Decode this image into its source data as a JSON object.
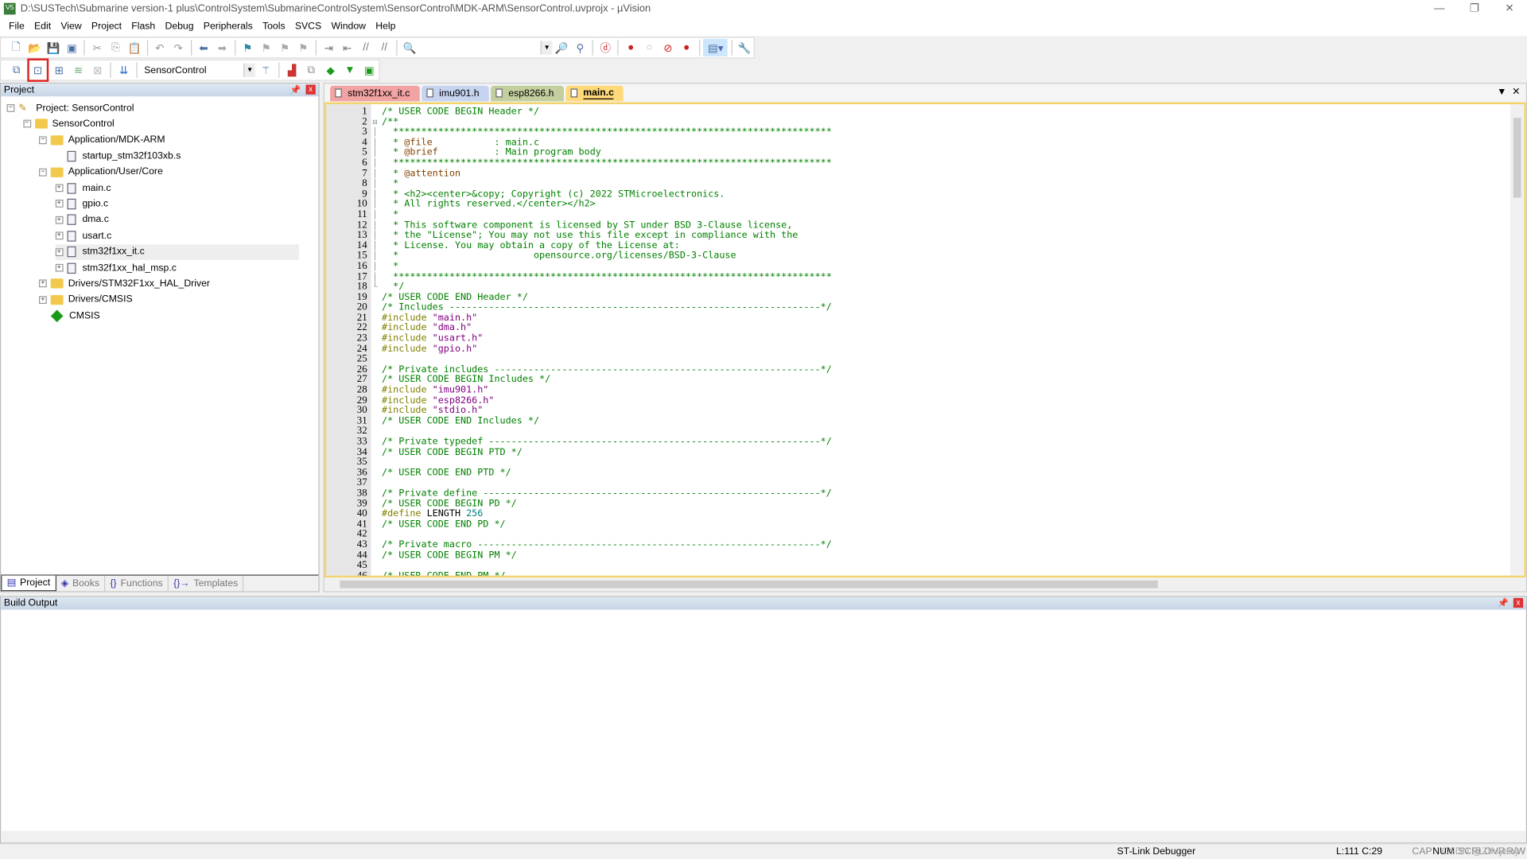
{
  "window": {
    "title": "D:\\SUSTech\\Submarine version-1 plus\\ControlSystem\\SubmarineControlSystem\\SensorControl\\MDK-ARM\\SensorControl.uvprojx - µVision",
    "logo": "V5"
  },
  "menu": [
    "File",
    "Edit",
    "View",
    "Project",
    "Flash",
    "Debug",
    "Peripherals",
    "Tools",
    "SVCS",
    "Window",
    "Help"
  ],
  "toolbar2": {
    "target": "SensorControl",
    "highlighted_button": "build-icon",
    "highlight_color": "#e02020"
  },
  "project_pane": {
    "title": "Project",
    "tree": [
      {
        "label": "Project: SensorControl",
        "depth": 0,
        "kind": "project",
        "exp": "−"
      },
      {
        "label": "SensorControl",
        "depth": 1,
        "kind": "folder",
        "exp": "−"
      },
      {
        "label": "Application/MDK-ARM",
        "depth": 2,
        "kind": "folder",
        "exp": "−"
      },
      {
        "label": "startup_stm32f103xb.s",
        "depth": 3,
        "kind": "file",
        "exp": ""
      },
      {
        "label": "Application/User/Core",
        "depth": 2,
        "kind": "folder",
        "exp": "−"
      },
      {
        "label": "main.c",
        "depth": 3,
        "kind": "file",
        "exp": "+"
      },
      {
        "label": "gpio.c",
        "depth": 3,
        "kind": "file",
        "exp": "+"
      },
      {
        "label": "dma.c",
        "depth": 3,
        "kind": "file",
        "exp": "+"
      },
      {
        "label": "usart.c",
        "depth": 3,
        "kind": "file",
        "exp": "+"
      },
      {
        "label": "stm32f1xx_it.c",
        "depth": 3,
        "kind": "file",
        "exp": "+",
        "selected": true
      },
      {
        "label": "stm32f1xx_hal_msp.c",
        "depth": 3,
        "kind": "file",
        "exp": "+"
      },
      {
        "label": "Drivers/STM32F1xx_HAL_Driver",
        "depth": 2,
        "kind": "folder",
        "exp": "+"
      },
      {
        "label": "Drivers/CMSIS",
        "depth": 2,
        "kind": "folder",
        "exp": "+"
      },
      {
        "label": "CMSIS",
        "depth": 2,
        "kind": "component",
        "exp": ""
      }
    ],
    "tabs": [
      {
        "label": "Project",
        "icon": "▤",
        "active": true
      },
      {
        "label": "Books",
        "icon": "◈"
      },
      {
        "label": "Functions",
        "icon": "{}"
      },
      {
        "label": "Templates",
        "icon": "{}→"
      }
    ]
  },
  "editor": {
    "tabs": [
      {
        "label": "stm32f1xx_it.c",
        "color": "#f2a3a3"
      },
      {
        "label": "imu901.h",
        "color": "#c6d4f0"
      },
      {
        "label": "esp8266.h",
        "color": "#c3cf9f"
      },
      {
        "label": "main.c",
        "color": "#ffd97a",
        "active": true
      }
    ],
    "lines": [
      [
        [
          "c",
          "/* USER CODE BEGIN Header */"
        ]
      ],
      [
        [
          "c",
          "/**"
        ]
      ],
      [
        [
          "c",
          "  ******************************************************************************"
        ]
      ],
      [
        [
          "c",
          "  * "
        ],
        [
          "d",
          "@file"
        ],
        [
          "c",
          "           : main.c"
        ]
      ],
      [
        [
          "c",
          "  * "
        ],
        [
          "d",
          "@brief"
        ],
        [
          "c",
          "          : Main program body"
        ]
      ],
      [
        [
          "c",
          "  ******************************************************************************"
        ]
      ],
      [
        [
          "c",
          "  * "
        ],
        [
          "d",
          "@attention"
        ]
      ],
      [
        [
          "c",
          "  *"
        ]
      ],
      [
        [
          "c",
          "  * <h2><center>&copy; Copyright (c) 2022 STMicroelectronics."
        ]
      ],
      [
        [
          "c",
          "  * All rights reserved.</center></h2>"
        ]
      ],
      [
        [
          "c",
          "  *"
        ]
      ],
      [
        [
          "c",
          "  * This software component is licensed by ST under BSD 3-Clause license,"
        ]
      ],
      [
        [
          "c",
          "  * the \"License\"; You may not use this file except in compliance with the"
        ]
      ],
      [
        [
          "c",
          "  * License. You may obtain a copy of the License at:"
        ]
      ],
      [
        [
          "c",
          "  *                        opensource.org/licenses/BSD-3-Clause"
        ]
      ],
      [
        [
          "c",
          "  *"
        ]
      ],
      [
        [
          "c",
          "  ******************************************************************************"
        ]
      ],
      [
        [
          "c",
          "  */"
        ]
      ],
      [
        [
          "c",
          "/* USER CODE END Header */"
        ]
      ],
      [
        [
          "c",
          "/* Includes ------------------------------------------------------------------*/"
        ]
      ],
      [
        [
          "p",
          "#include "
        ],
        [
          "s",
          "\"main.h\""
        ]
      ],
      [
        [
          "p",
          "#include "
        ],
        [
          "s",
          "\"dma.h\""
        ]
      ],
      [
        [
          "p",
          "#include "
        ],
        [
          "s",
          "\"usart.h\""
        ]
      ],
      [
        [
          "p",
          "#include "
        ],
        [
          "s",
          "\"gpio.h\""
        ]
      ],
      [],
      [
        [
          "c",
          "/* Private includes ----------------------------------------------------------*/"
        ]
      ],
      [
        [
          "c",
          "/* USER CODE BEGIN Includes */"
        ]
      ],
      [
        [
          "p",
          "#include "
        ],
        [
          "s",
          "\"imu901.h\""
        ]
      ],
      [
        [
          "p",
          "#include "
        ],
        [
          "s",
          "\"esp8266.h\""
        ]
      ],
      [
        [
          "p",
          "#include "
        ],
        [
          "s",
          "\"stdio.h\""
        ]
      ],
      [
        [
          "c",
          "/* USER CODE END Includes */"
        ]
      ],
      [],
      [
        [
          "c",
          "/* Private typedef -----------------------------------------------------------*/"
        ]
      ],
      [
        [
          "c",
          "/* USER CODE BEGIN PTD */"
        ]
      ],
      [],
      [
        [
          "c",
          "/* USER CODE END PTD */"
        ]
      ],
      [],
      [
        [
          "c",
          "/* Private define ------------------------------------------------------------*/"
        ]
      ],
      [
        [
          "c",
          "/* USER CODE BEGIN PD */"
        ]
      ],
      [
        [
          "p",
          "#define "
        ],
        [
          "t",
          "LENGTH "
        ],
        [
          "n",
          "256"
        ]
      ],
      [
        [
          "c",
          "/* USER CODE END PD */"
        ]
      ],
      [],
      [
        [
          "c",
          "/* Private macro -------------------------------------------------------------*/"
        ]
      ],
      [
        [
          "c",
          "/* USER CODE BEGIN PM */"
        ]
      ],
      [],
      [
        [
          "c",
          "/* USER CODE END PM */"
        ]
      ]
    ]
  },
  "build_output": {
    "title": "Build Output"
  },
  "status": {
    "debugger": "ST-Link Debugger",
    "position": "L:111 C:29",
    "cap": "CAP",
    "num": "NUM",
    "scrl": "SCRL",
    "ovr": "OVR",
    "rw": "R/W",
    "watermark": "CSDN @Zhuyany"
  }
}
